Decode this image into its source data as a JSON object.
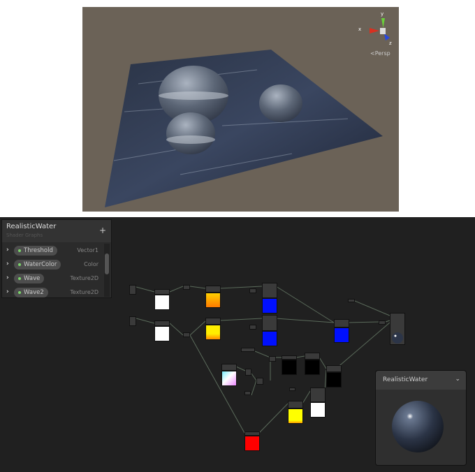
{
  "scene": {
    "gizmo": {
      "y": "y",
      "x": "x",
      "z": "z"
    },
    "projection": "Persp"
  },
  "blackboard": {
    "title": "RealisticWater",
    "subtitle": "Shader Graphs",
    "add_label": "+",
    "properties": [
      {
        "name": "Threshold",
        "type": "Vector1"
      },
      {
        "name": "WaterColor",
        "type": "Color"
      },
      {
        "name": "Wave",
        "type": "Texture2D"
      },
      {
        "name": "Wave2",
        "type": "Texture2D"
      }
    ]
  },
  "preview": {
    "title": "RealisticWater",
    "menu": "⌄"
  },
  "colors": {
    "accent_green": "#7bd36b"
  }
}
